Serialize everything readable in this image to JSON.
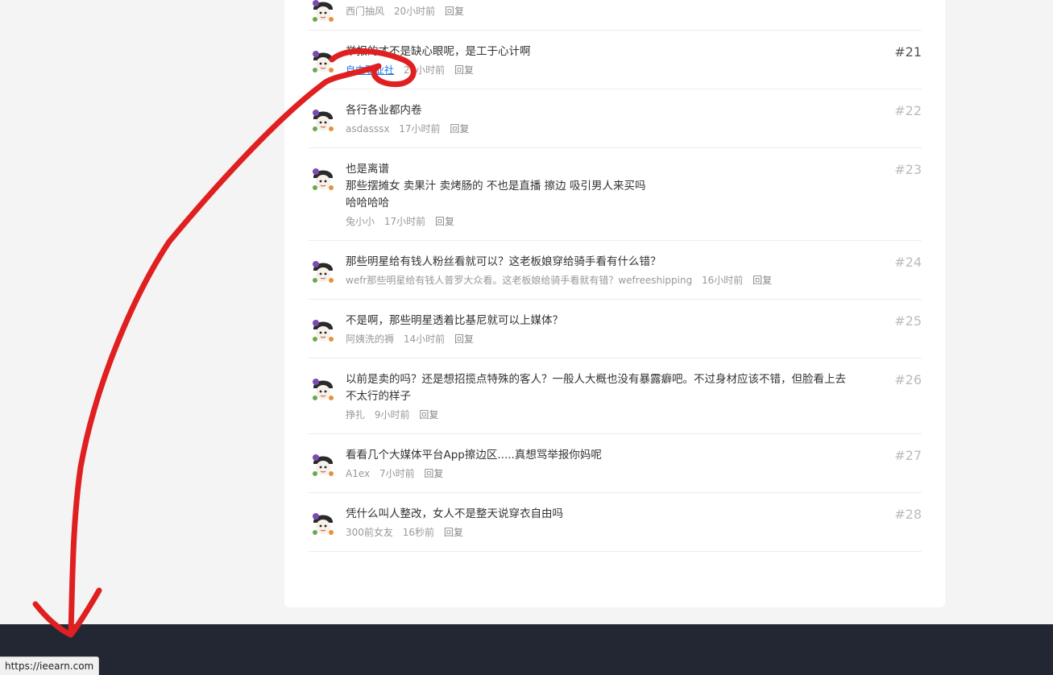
{
  "comments": [
    {
      "lines": [],
      "author": "西门抽风",
      "time": "20小时前",
      "reply": "回复",
      "floor": ""
    },
    {
      "lines": [
        "举报的才不是缺心眼呢，是工于心计啊"
      ],
      "author": "自由职业社",
      "time": "20小时前",
      "reply": "回复",
      "floor": "#21"
    },
    {
      "lines": [
        "各行各业都内卷"
      ],
      "author": "asdasssx",
      "time": "17小时前",
      "reply": "回复",
      "floor": "#22"
    },
    {
      "lines": [
        "也是离谱",
        "那些摆摊女 卖果汁 卖烤肠的 不也是直播 擦边 吸引男人来买吗",
        "哈哈哈哈"
      ],
      "author": "兔小小",
      "time": "17小时前",
      "reply": "回复",
      "floor": "#23"
    },
    {
      "lines": [
        "那些明星给有钱人粉丝看就可以？这老板娘穿给骑手看有什么错？"
      ],
      "author": "wefr那些明星给有钱人普罗大众看。这老板娘给骑手看就有错？wefreeshipping",
      "time": "16小时前",
      "reply": "回复",
      "floor": "#24"
    },
    {
      "lines": [
        "不是啊，那些明星透着比基尼就可以上媒体？"
      ],
      "author": "阿姨洗的褥",
      "time": "14小时前",
      "reply": "回复",
      "floor": "#25"
    },
    {
      "lines": [
        "以前是卖的吗？还是想招揽点特殊的客人？一般人大概也没有暴露癖吧。不过身材应该不错，但脸看上去",
        "不太行的样子"
      ],
      "author": "挣扎",
      "time": "9小时前",
      "reply": "回复",
      "floor": "#26"
    },
    {
      "lines": [
        "看看几个大媒体平台App擦边区.....真想骂举报你妈呢"
      ],
      "author": "A1ex",
      "time": "7小时前",
      "reply": "回复",
      "floor": "#27"
    },
    {
      "lines": [
        "凭什么叫人整改，女人不是整天说穿衣自由吗"
      ],
      "author": "300前女友",
      "time": "16秒前",
      "reply": "回复",
      "floor": "#28"
    }
  ],
  "status_bar": {
    "url": "https://ieearn.com"
  },
  "colors": {
    "annotation": "#e02020",
    "footer": "#232733",
    "link": "#1a73e8"
  }
}
